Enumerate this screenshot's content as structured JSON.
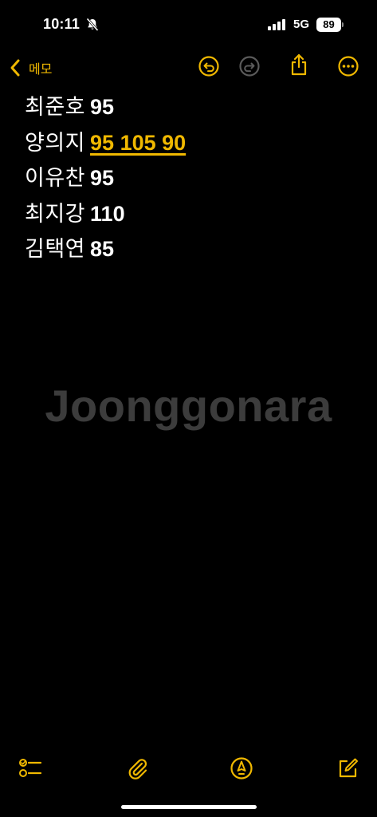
{
  "status_bar": {
    "time": "10:11",
    "network": "5G",
    "battery": "89"
  },
  "nav": {
    "back_label": "메모",
    "accent_color": "#f0b800"
  },
  "note": {
    "lines": [
      {
        "name": "최준호",
        "value": "95"
      },
      {
        "name": "양의지",
        "value": "95 105 90"
      },
      {
        "name": "이유찬",
        "value": "95"
      },
      {
        "name": "최지강",
        "value": "110"
      },
      {
        "name": "김택연",
        "value": "85"
      }
    ]
  },
  "watermark": "Joonggonara",
  "toolbar": {
    "icons": [
      "checklist-icon",
      "paperclip-icon",
      "markup-icon",
      "compose-icon"
    ]
  }
}
